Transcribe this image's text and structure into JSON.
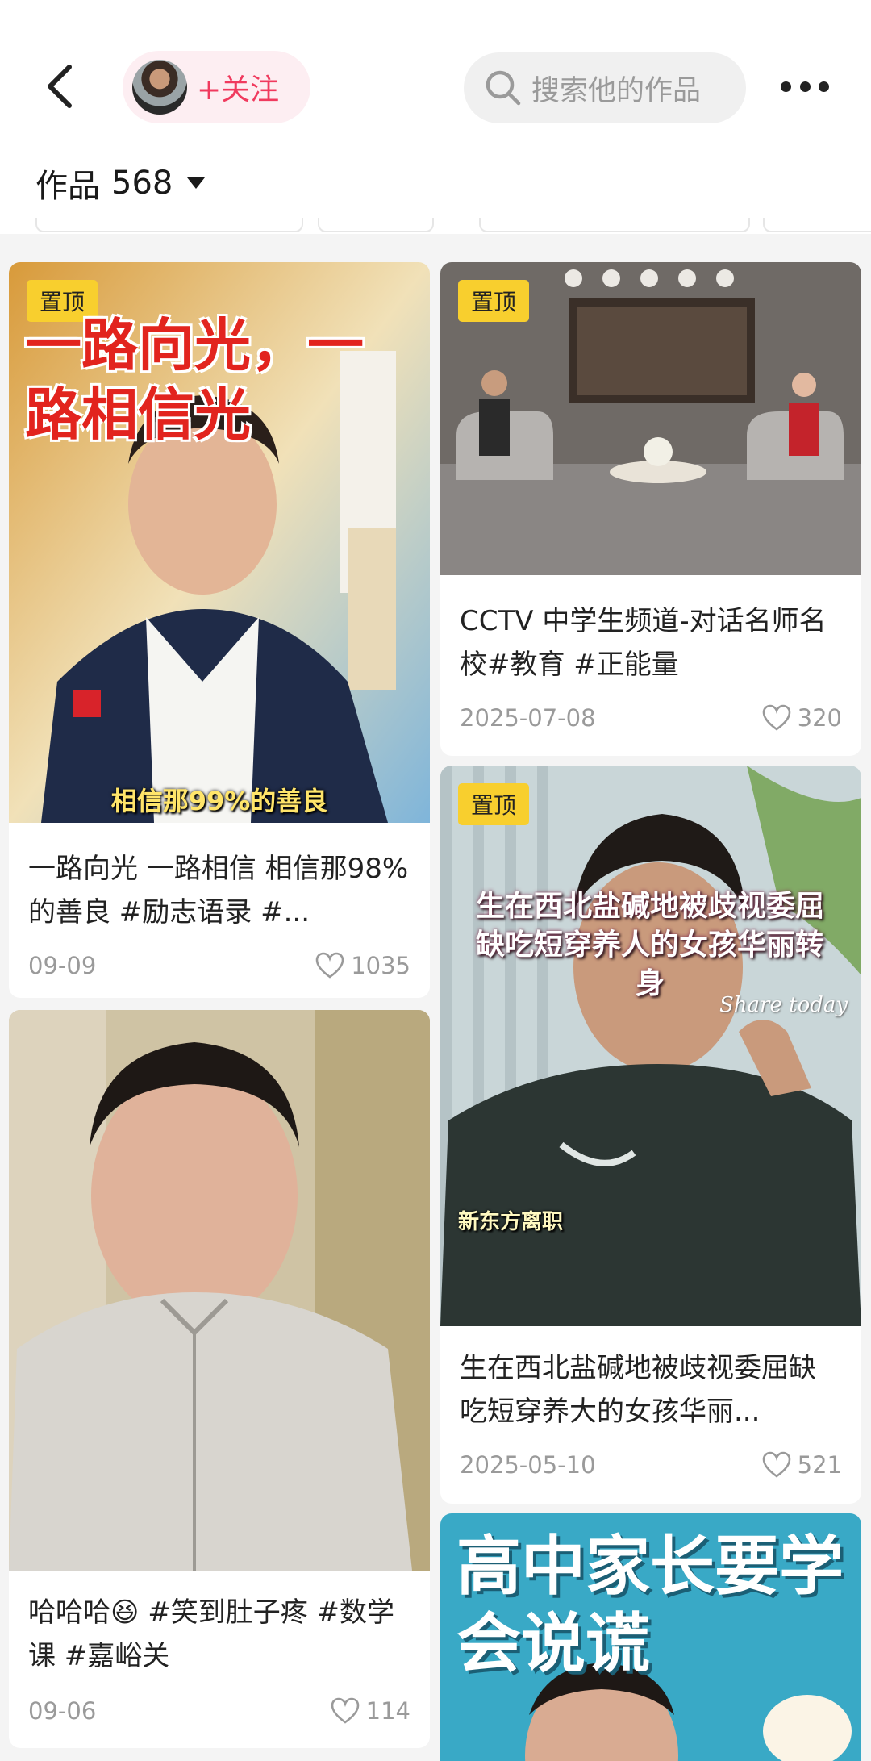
{
  "header": {
    "follow_label": "+关注",
    "search_placeholder": "搜索他的作品",
    "works_label": "作品",
    "works_count": "568"
  },
  "cards": [
    {
      "pin": "置顶",
      "overlay_title": "一路向光，一路相信光",
      "overlay_caption": "相信那99%的善良",
      "title": "一路向光 一路相信 相信那98%的善良 #励志语录 #...",
      "date": "09-09",
      "likes": "1035"
    },
    {
      "pin": "置顶",
      "title": "CCTV 中学生频道-对话名师名校#教育 #正能量",
      "date": "2025-07-08",
      "likes": "320"
    },
    {
      "pin": "置顶",
      "overlay_title": "生在西北盐碱地被歧视委屈缺吃短穿养人的女孩华丽转身",
      "overlay_script": "Share today",
      "overlay_tag": "新东方离职",
      "title": "生在西北盐碱地被歧视委屈缺吃短穿养大的女孩华丽...",
      "date": "2025-05-10",
      "likes": "521"
    },
    {
      "title": "哈哈哈😆 #笑到肚子疼 #数学课 #嘉峪关",
      "date": "09-06",
      "likes": "114"
    },
    {
      "overlay_title": "高中家长要学会说谎"
    }
  ],
  "colors": {
    "accent": "#f03a5e",
    "pin": "#f8cf2e",
    "meta": "#9a9a9a"
  }
}
